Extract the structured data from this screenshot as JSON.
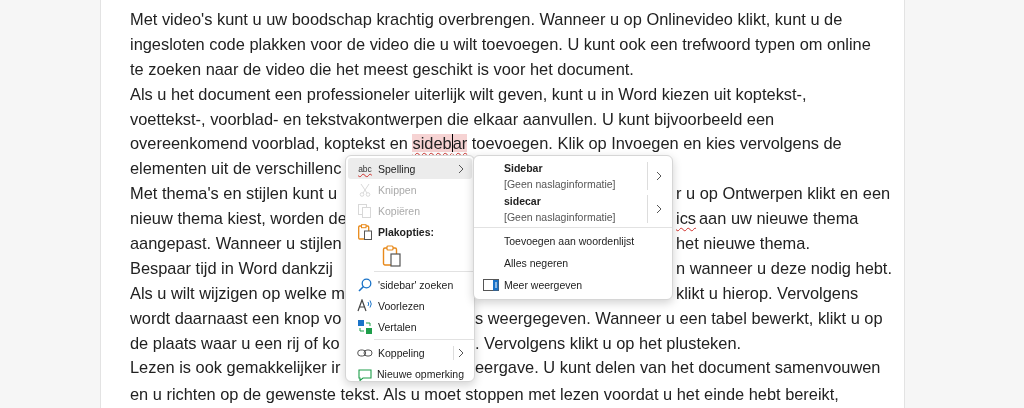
{
  "document": {
    "lines": [
      {
        "parts": [
          {
            "kind": "plain",
            "text": "Met video's kunt u uw boodschap krachtig overbrengen. Wanneer u op Onlinevideo klikt, kunt u de"
          }
        ]
      },
      {
        "parts": [
          {
            "kind": "plain",
            "text": "ingesloten code plakken voor de video die u wilt toevoegen. U kunt ook een trefwoord typen om online"
          }
        ]
      },
      {
        "parts": [
          {
            "kind": "plain",
            "text": "te zoeken naar de video die het meest geschikt is voor het document."
          }
        ]
      },
      {
        "parts": [
          {
            "kind": "plain",
            "text": "Als u het document een professioneler uiterlijk wilt geven, kunt u in Word kiezen uit koptekst-,"
          }
        ]
      },
      {
        "parts": [
          {
            "kind": "plain",
            "text": "voettekst-, voorblad- en tekstvakontwerpen die elkaar aanvullen. U kunt bijvoorbeeld een"
          }
        ]
      },
      {
        "parts": [
          {
            "kind": "plain",
            "text": "overeenkomend voorblad, koptekst en "
          },
          {
            "kind": "selected_misspelled",
            "text": "sideb"
          },
          {
            "kind": "caret"
          },
          {
            "kind": "selected_misspelled",
            "text": "ar"
          },
          {
            "kind": "plain",
            "text": " toevoegen. Klik op Invoegen en kies vervolgens de"
          }
        ]
      },
      {
        "parts": [
          {
            "kind": "plain",
            "text": "elementen uit de verschillenc"
          }
        ]
      },
      {
        "parts": [
          {
            "kind": "plain",
            "text": "Met thema's en stijlen kunt u"
          },
          {
            "kind": "after_submenu",
            "text": "r u op Ontwerpen klikt en een"
          }
        ]
      },
      {
        "parts": [
          {
            "kind": "plain",
            "text": "nieuw thema kiest, worden de"
          },
          {
            "kind": "after_submenu_misspelled",
            "text": "ics"
          },
          {
            "kind": "plain",
            "text": " aan uw nieuwe thema"
          }
        ]
      },
      {
        "parts": [
          {
            "kind": "plain",
            "text": "aangepast. Wanneer u stijlen"
          },
          {
            "kind": "after_submenu",
            "text": "het nieuwe thema."
          }
        ]
      },
      {
        "parts": [
          {
            "kind": "plain",
            "text": "Bespaar tijd in Word dankzij"
          },
          {
            "kind": "after_submenu",
            "text": "n wanneer u deze nodig hebt."
          }
        ]
      },
      {
        "parts": [
          {
            "kind": "plain",
            "text": "Als u wilt wijzigen op welke m"
          },
          {
            "kind": "after_submenu",
            "text": "klikt u hierop. Vervolgens"
          }
        ]
      },
      {
        "parts": [
          {
            "kind": "plain",
            "text": "wordt daarnaast een knop vo"
          },
          {
            "kind": "after_menu",
            "text": "s weergegeven. Wanneer u een tabel bewerkt, klikt u op"
          }
        ]
      },
      {
        "parts": [
          {
            "kind": "plain",
            "text": "de plaats waar u een rij of ko"
          },
          {
            "kind": "after_menu",
            "text": ". Vervolgens klikt u op het plusteken."
          }
        ]
      },
      {
        "parts": [
          {
            "kind": "plain",
            "text": "Lezen is ook gemakkelijker ir"
          },
          {
            "kind": "after_menu",
            "text": "eergave. U kunt delen van het document samenvouwen"
          }
        ]
      },
      {
        "parts": [
          {
            "kind": "plain",
            "text": "en u richten op de gewenste tekst. Als u moet stoppen met lezen voordat u het einde hebt bereikt,"
          }
        ]
      }
    ]
  },
  "context_menu": {
    "items": [
      {
        "kind": "submenu",
        "label": "Spelling",
        "icon_text": "abc",
        "disabled": false,
        "highlighted": true,
        "divider_before": false
      },
      {
        "kind": "item",
        "label": "Knippen",
        "disabled": true,
        "highlighted": false,
        "divider_before": false
      },
      {
        "kind": "item",
        "label": "Kopiëren",
        "disabled": true,
        "highlighted": false,
        "divider_before": false
      },
      {
        "kind": "header",
        "label": "Plakopties:",
        "disabled": false,
        "highlighted": false,
        "divider_before": false
      },
      {
        "kind": "paste_option",
        "disabled": false,
        "highlighted": false,
        "divider_before": false
      },
      {
        "kind": "item",
        "label": "'sidebar' zoeken",
        "disabled": false,
        "highlighted": false,
        "divider_before": true
      },
      {
        "kind": "item",
        "label": "Voorlezen",
        "disabled": false,
        "highlighted": false,
        "divider_before": false
      },
      {
        "kind": "item",
        "label": "Vertalen",
        "disabled": false,
        "highlighted": false,
        "divider_before": false
      },
      {
        "kind": "split_submenu",
        "label": "Koppeling",
        "disabled": false,
        "highlighted": false,
        "divider_before": true
      },
      {
        "kind": "item",
        "label": "Nieuwe opmerking",
        "disabled": false,
        "highlighted": false,
        "divider_before": false
      }
    ]
  },
  "spelling_submenu": {
    "items": [
      {
        "kind": "suggestion",
        "word": "Sidebar",
        "info": "[Geen naslaginformatie]",
        "divider_before": false
      },
      {
        "kind": "suggestion",
        "word": "sidecar",
        "info": "[Geen naslaginformatie]",
        "divider_before": false
      },
      {
        "kind": "action",
        "label": "Toevoegen aan woordenlijst",
        "divider_before": true
      },
      {
        "kind": "action",
        "label": "Alles negeren",
        "divider_before": false
      },
      {
        "kind": "action_icon",
        "label": "Meer weergeven",
        "divider_before": false
      }
    ]
  }
}
